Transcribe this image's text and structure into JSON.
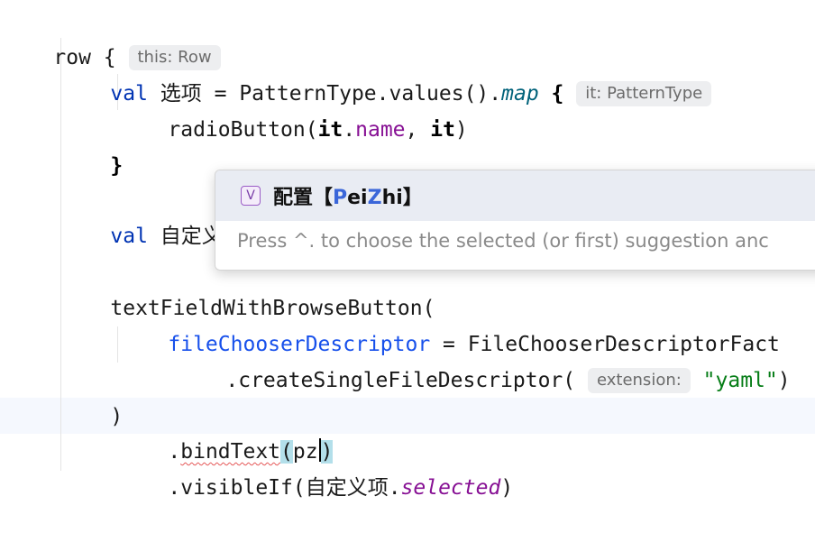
{
  "editor": {
    "lines": {
      "l1": {
        "code": "row {",
        "hint": "this: Row"
      },
      "l2": {
        "kw": "val",
        "name": "选项 = PatternType.values().",
        "fn": "map",
        "brace": " {",
        "hint": "it: PatternType"
      },
      "l3": {
        "fn": "radioButton(",
        "it1": "it",
        "dot": ".",
        "prop": "name",
        "rest": ", ",
        "it2": "it",
        "close": ")"
      },
      "l4": {
        "code": "}"
      },
      "l5": {
        "kw": "val",
        "name": "自定义项"
      },
      "l6": {
        "code": "textFieldWithBrowseButton("
      },
      "l7": {
        "param": "fileChooserDescriptor",
        "rest": " = FileChooserDescriptorFact"
      },
      "l8": {
        "code": ".createSingleFileDescriptor(",
        "hint": "extension:",
        "str": "\"yaml\"",
        "close": ")"
      },
      "l9": {
        "code": ")"
      },
      "l10": {
        "pre": ".",
        "fn": "bindText",
        "open": "(",
        "arg": "pz",
        "close": ")"
      },
      "l11": {
        "code": ".visibleIf(自定义项.",
        "sel": "selected",
        "close": ")"
      }
    }
  },
  "completion": {
    "icon_letter": "V",
    "item_prefix": "配置【",
    "item_hl1": "P",
    "item_mid": "ei",
    "item_hl2": "Z",
    "item_suffix": "hi】",
    "footer": "Press ^. to choose the selected (or first) suggestion anc"
  },
  "colors": {
    "keyword": "#0033b3",
    "property": "#871094",
    "string": "#067d17",
    "popup_selection": "#e9ecf3"
  }
}
